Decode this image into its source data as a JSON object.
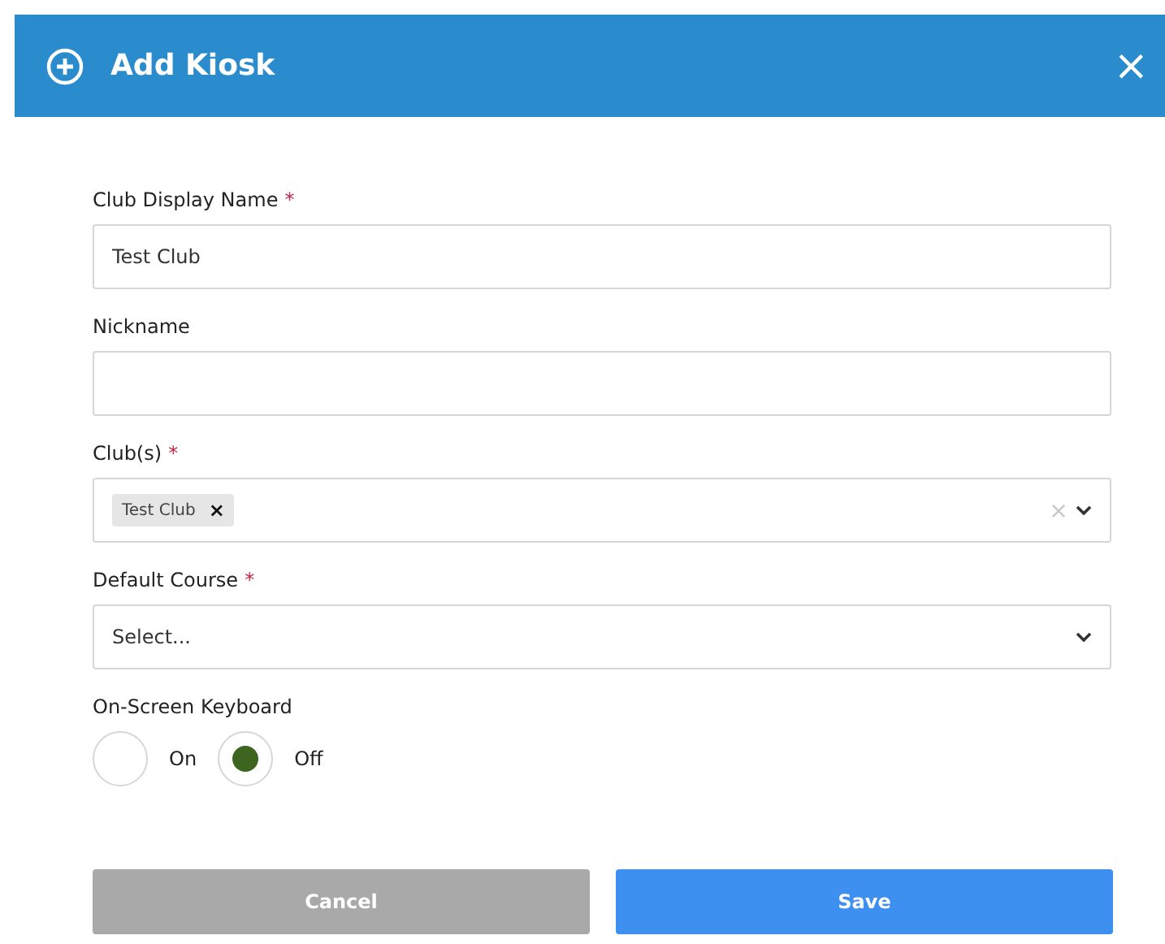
{
  "dialog": {
    "title": "Add Kiosk",
    "close": "×"
  },
  "fields": [
    {
      "kind": "text",
      "label": "Club Display Name",
      "required_mark": "*",
      "value": "Test Club"
    },
    {
      "kind": "text",
      "label": "Nickname"
    },
    {
      "kind": "multiselect",
      "label": "Club(s)",
      "required_mark": "*",
      "tags": [
        {
          "label": "Test Club",
          "remove": "×"
        }
      ]
    },
    {
      "kind": "select",
      "label": "Default Course",
      "required_mark": "*",
      "placeholder": "Select..."
    }
  ],
  "keyboard": {
    "label": "On-Screen Keyboard",
    "options": [
      {
        "label": "On",
        "selected": false
      },
      {
        "label": "Off",
        "selected": true
      }
    ]
  },
  "buttons": [
    {
      "label": "Cancel",
      "kind": "secondary"
    },
    {
      "label": "Save",
      "kind": "primary"
    }
  ]
}
